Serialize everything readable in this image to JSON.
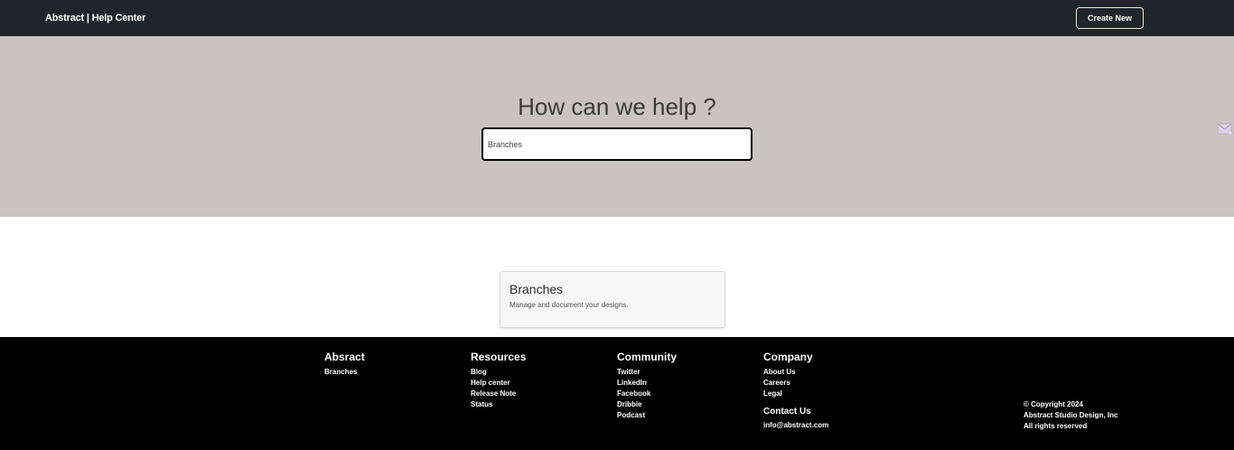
{
  "header": {
    "brand": "Abstract | Help Center",
    "create_button": "Create New"
  },
  "hero": {
    "title": "How can we help ?",
    "search_value": "Branches"
  },
  "result": {
    "title": "Branches",
    "description": "Manage and document your designs."
  },
  "footer": {
    "columns": [
      {
        "title": "Absract",
        "links": [
          "Branches"
        ]
      },
      {
        "title": "Resources",
        "links": [
          "Blog",
          "Help center",
          "Release Note",
          "Status"
        ]
      },
      {
        "title": "Community",
        "links": [
          "Twitter",
          "LinkedIn",
          "Facebook",
          "Dribbie",
          "Podcast"
        ]
      },
      {
        "title": "Company",
        "links": [
          "About Us",
          "Careers",
          "Legal"
        ]
      }
    ],
    "contact": {
      "title": "Contact Us",
      "email": "info@abstract.com"
    },
    "copyright": [
      "© Copyright 2024",
      "Abstract Studio Design, Inc",
      "All rights reserved"
    ]
  },
  "side_icon": "mail-icon"
}
